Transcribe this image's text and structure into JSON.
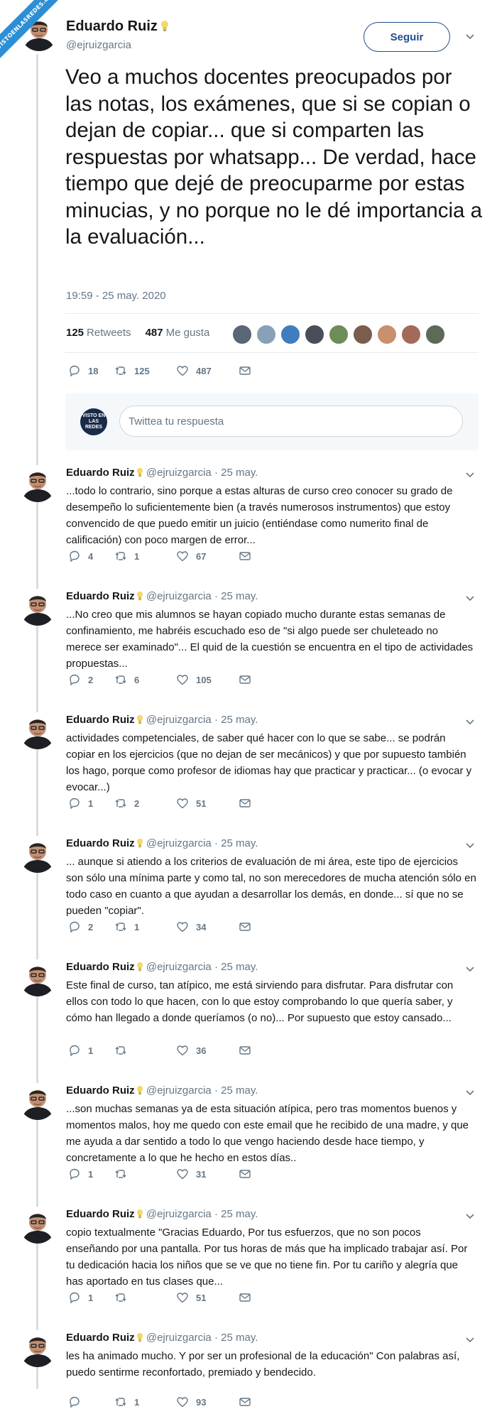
{
  "watermark": "VISTOENLASREDES.com",
  "main_tweet": {
    "name": "Eduardo Ruiz",
    "handle": "@ejruizgarcia",
    "follow_label": "Seguir",
    "text": "Veo a muchos docentes preocupados por las notas, los exámenes, que si se copian o dejan de copiar... que si comparten las respuestas por whatsapp... De verdad, hace tiempo que dejé de preocuparme por estas minucias, y no porque no le dé importancia a la evaluación...",
    "timestamp": "19:59 - 25 may. 2020",
    "retweets_count": "125",
    "retweets_label": "Retweets",
    "likes_count": "487",
    "likes_label": "Me gusta",
    "replies": "18",
    "rts": "125",
    "likes": "487"
  },
  "reply_box": {
    "avatar_text": "VISTO EN LAS REDES",
    "placeholder": "Twittea tu respuesta"
  },
  "replies": [
    {
      "name": "Eduardo Ruiz",
      "handle": "@ejruizgarcia",
      "date": "25 may.",
      "text": "...todo lo contrario, sino porque a estas alturas de curso creo conocer su grado de desempeño lo suficientemente bien (a través numerosos instrumentos) que estoy convencido de que puedo emitir un juicio (entiéndase como numerito final de calificación) con poco margen de error...",
      "replies": "4",
      "rts": "1",
      "likes": "67"
    },
    {
      "name": "Eduardo Ruiz",
      "handle": "@ejruizgarcia",
      "date": "25 may.",
      "text": "...No creo que mis alumnos se hayan copiado mucho durante estas semanas de confinamiento, me habréis escuchado eso de \"si algo puede ser chuleteado no merece ser examinado\"... El quid de la cuestión se encuentra en el tipo de actividades propuestas...",
      "replies": "2",
      "rts": "6",
      "likes": "105"
    },
    {
      "name": "Eduardo Ruiz",
      "handle": "@ejruizgarcia",
      "date": "25 may.",
      "text": "actividades competenciales, de saber qué hacer con lo que se sabe... se podrán copiar en los ejercicios (que no dejan de ser mecánicos) y que por supuesto también los hago, porque como profesor de idiomas hay que practicar y practicar... (o evocar y evocar...)",
      "replies": "1",
      "rts": "2",
      "likes": "51"
    },
    {
      "name": "Eduardo Ruiz",
      "handle": "@ejruizgarcia",
      "date": "25 may.",
      "text": "... aunque si atiendo a los criterios de evaluación de mi área, este tipo de ejercicios son sólo una mínima parte y como tal, no son merecedores de mucha atención sólo en todo caso en cuanto a que ayudan a desarrollar los demás, en donde... sí que no se pueden \"copiar\".",
      "replies": "2",
      "rts": "1",
      "likes": "34"
    },
    {
      "name": "Eduardo Ruiz",
      "handle": "@ejruizgarcia",
      "date": "25 may.",
      "text": "Este final de curso, tan atípico, me está sirviendo para disfrutar. Para disfrutar con ellos con todo lo que hacen, con lo que estoy comprobando lo que quería saber, y cómo han llegado a donde queríamos (o no)... Por supuesto que estoy cansado...",
      "replies": "1",
      "rts": "",
      "likes": "36"
    },
    {
      "name": "Eduardo Ruiz",
      "handle": "@ejruizgarcia",
      "date": "25 may.",
      "text": "...son muchas semanas ya de esta situación atípica, pero tras momentos buenos y momentos malos, hoy me quedo con este email que he recibido de una madre, y que me ayuda a dar sentido a todo lo que vengo haciendo desde hace tiempo, y concretamente a lo que he hecho en estos días..",
      "replies": "1",
      "rts": "",
      "likes": "31"
    },
    {
      "name": "Eduardo Ruiz",
      "handle": "@ejruizgarcia",
      "date": "25 may.",
      "text": "copio textualmente \"Gracias Eduardo, Por tus esfuerzos, que no son pocos enseñando por una pantalla. Por tus horas de más que ha implicado trabajar así. Por tu dedicación hacia los niños que se ve que no tiene fin. Por tu cariño y alegría que has aportado en tus clases que...",
      "replies": "1",
      "rts": "",
      "likes": "51"
    },
    {
      "name": "Eduardo Ruiz",
      "handle": "@ejruizgarcia",
      "date": "25 may.",
      "text": "les ha animado mucho. Y por ser un profesional de la educación\" Con palabras así, puedo sentirme reconfortado, premiado y bendecido.",
      "replies": "",
      "rts": "1",
      "likes": "93"
    }
  ],
  "colors": {
    "accent": "#1f4e8c",
    "text": "#14171a",
    "muted": "#657786",
    "thread_line": "#d7dde3",
    "watermark": "#2b8fd6"
  },
  "icons": [
    "reply-icon",
    "retweet-icon",
    "like-icon",
    "message-icon",
    "caret-down-icon",
    "lightbulb-icon"
  ]
}
